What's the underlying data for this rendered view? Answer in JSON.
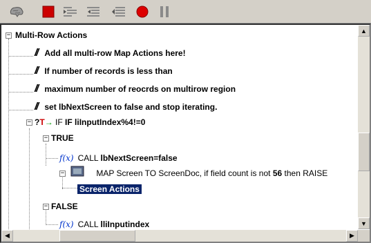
{
  "toolbar": {
    "buttons": [
      {
        "icon": "brain-icon"
      },
      {
        "icon": "stop-square-icon",
        "color": "#cc0000"
      },
      {
        "icon": "indent-right-icon"
      },
      {
        "icon": "indent-left-icon"
      },
      {
        "icon": "outdent-icon"
      },
      {
        "icon": "record-icon",
        "color": "#cc0000"
      },
      {
        "icon": "pause-icon"
      }
    ]
  },
  "tree": {
    "root": "Multi-Row Actions",
    "comment_1": "Add all multi-row Map Actions here!",
    "comment_2": "If number of records is less than",
    "comment_3": "maximum number of reocrds on multirow region",
    "comment_4": "set lbNextScreen to false and stop iterating.",
    "if_prefix": "IF",
    "if_condition": "IF liInputIndex%4!=0",
    "true_label": "TRUE",
    "call_1_prefix": "CALL",
    "call_1_text": "lbNextScreen=false",
    "map_text_pre": "MAP Screen TO ScreenDoc, if field count is not",
    "map_count": "56",
    "map_text_post": "then RAISE",
    "screen_actions": "Screen Actions",
    "false_label": "FALSE",
    "call_2_prefix": "CALL",
    "call_2_text": "lliInputindex",
    "fx_label": "f(x)",
    "comment_mark": "//",
    "if_icon_q": "?"
  },
  "colors": {
    "selection_bg": "#0a246a",
    "fx_blue": "#0033cc",
    "if_red": "#cc0000",
    "if_green": "#009900"
  }
}
